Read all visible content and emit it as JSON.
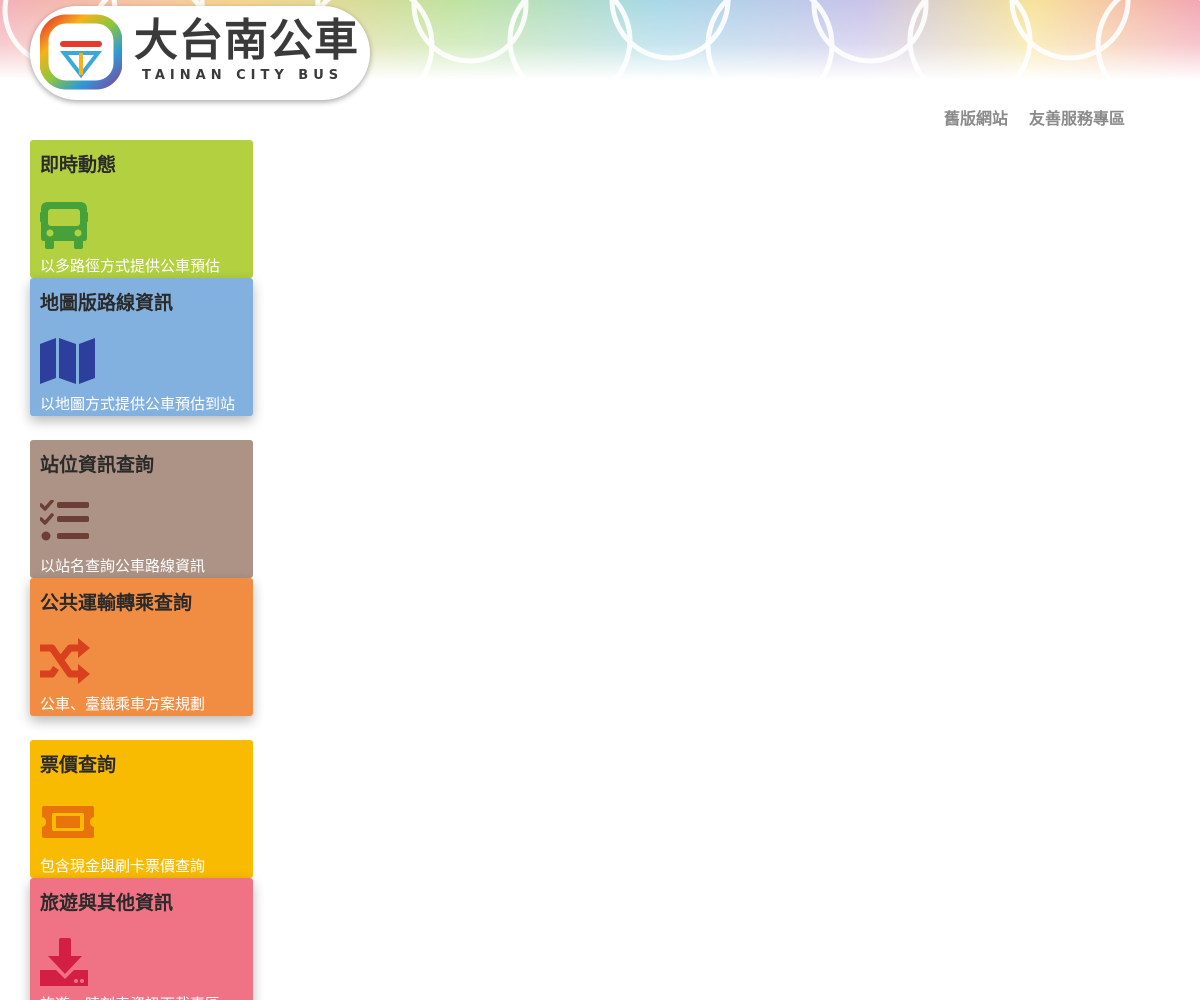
{
  "logo": {
    "title": "大台南公車",
    "subtitle": "TAINAN CITY BUS"
  },
  "nav": {
    "old_site": "舊版網站",
    "friendly_zone": "友善服務專區"
  },
  "colors": {
    "green": "#b2d040",
    "blue": "#83b1df",
    "brown": "#ac9385",
    "orange": "#f18d42",
    "yellow": "#f8bb01",
    "pink": "#ef7384"
  },
  "cards": [
    {
      "title": "即時動態",
      "desc": "以多路徑方式提供公車預估",
      "icon": "bus-icon"
    },
    {
      "title": "地圖版路線資訊",
      "desc": "以地圖方式提供公車預估到站資訊",
      "icon": "map-icon"
    },
    {
      "title": "站位資訊查詢",
      "desc": "以站名查詢公車路線資訊",
      "icon": "checklist-icon"
    },
    {
      "title": "公共運輸轉乘查詢",
      "desc": "公車、臺鐵乘車方案規劃",
      "icon": "shuffle-icon"
    },
    {
      "title": "票價查詢",
      "desc": "包含現金與刷卡票價查詢",
      "icon": "ticket-icon"
    },
    {
      "title": "旅遊與其他資訊",
      "desc": "旅遊、時刻表資訊下載專區",
      "icon": "download-icon"
    }
  ]
}
